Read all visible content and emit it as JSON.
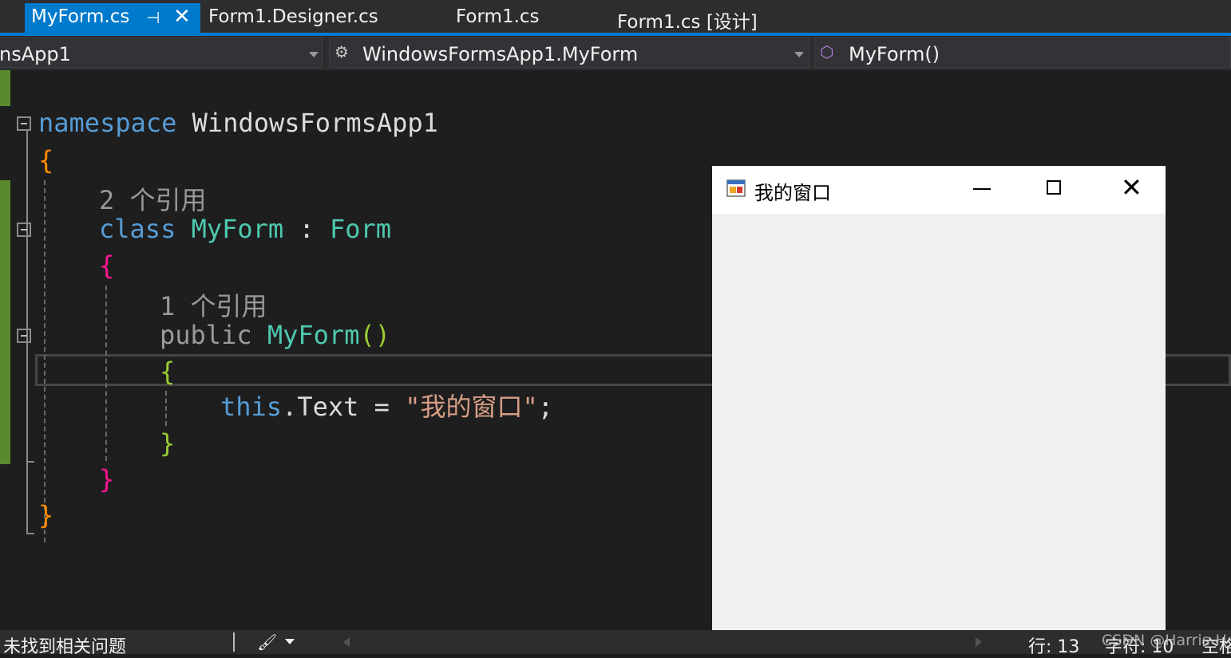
{
  "tabs": [
    {
      "label": "MyForm.cs",
      "active": true
    },
    {
      "label": "Form1.Designer.cs",
      "active": false
    },
    {
      "label": "Form1.cs",
      "active": false
    },
    {
      "label": "Form1.cs [设计]",
      "active": false
    }
  ],
  "tab_icons": {
    "pin": "pin-icon",
    "close": "close-icon"
  },
  "navbar": {
    "project": "nsApp1",
    "type": "WindowsFormsApp1.MyForm",
    "member": "MyForm()"
  },
  "code": {
    "namespace_kw": "namespace",
    "namespace_name": "WindowsFormsApp1",
    "open_brace": "{",
    "refs_2": "2 个引用",
    "class_kw": "class",
    "class_name": "MyForm",
    "colon": ":",
    "base_type": "Form",
    "refs_1": "1 个引用",
    "public_kw": "public",
    "ctor_name": "MyForm",
    "parens": "()",
    "this_kw": "this",
    "dot": ".",
    "prop": "Text",
    "eq": "=",
    "string_literal": "\"我的窗口\"",
    "semicolon": ";",
    "close_brace": "}"
  },
  "form_window": {
    "title": "我的窗口",
    "minimize": "minimize-icon",
    "maximize": "maximize-icon",
    "close": "close-icon"
  },
  "statusbar": {
    "issues": "未找到相关问题",
    "line": "行: 13",
    "char": "字符: 10",
    "spaces": "空格"
  },
  "watermark": "CSDN @Harris-H",
  "colors": {
    "accent": "#007acc",
    "keyword": "#569cd6",
    "type": "#4ec9b0",
    "string": "#d69d85",
    "brace_level1": "#ff8c00",
    "brace_level2": "#ff1493",
    "brace_level3": "#9acd32"
  }
}
